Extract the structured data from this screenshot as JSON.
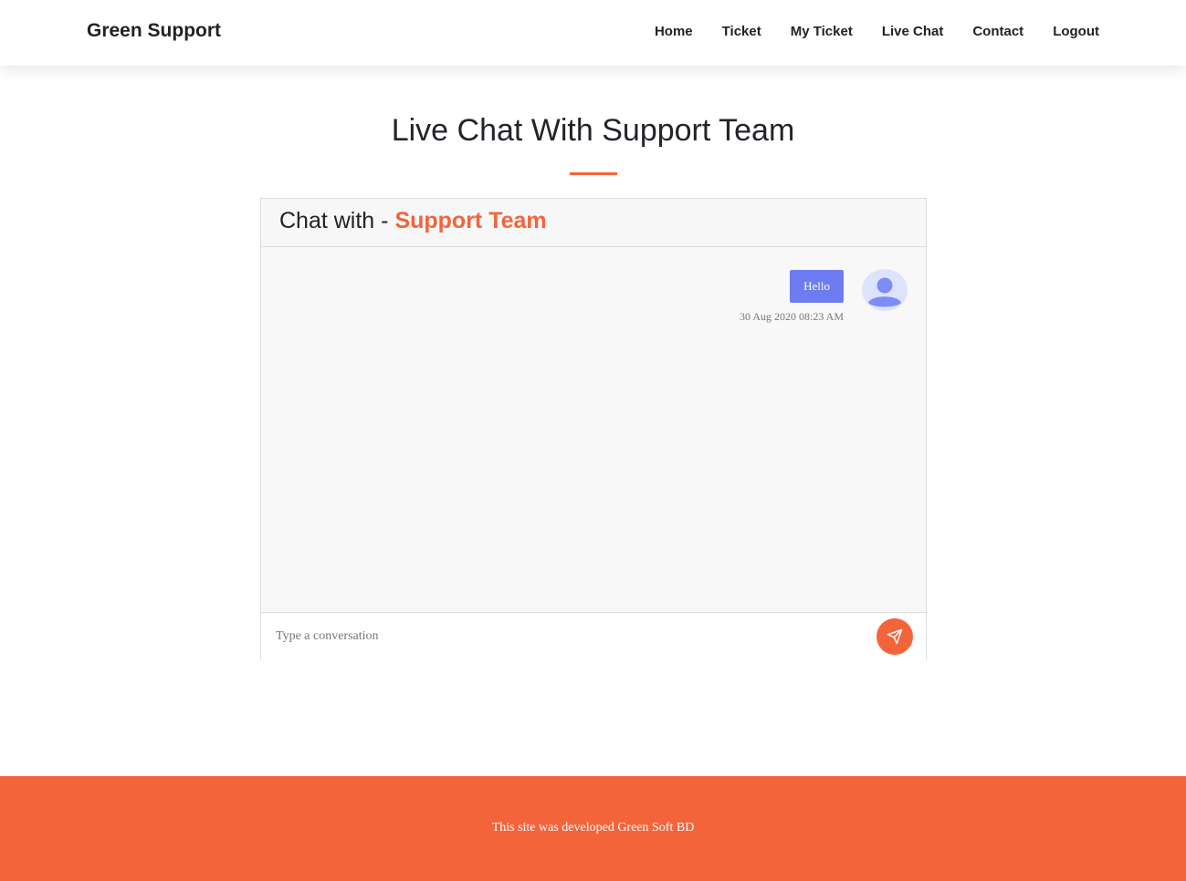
{
  "brand": {
    "name": "Green Support"
  },
  "nav": {
    "items": [
      {
        "label": "Home"
      },
      {
        "label": "Ticket"
      },
      {
        "label": "My Ticket"
      },
      {
        "label": "Live Chat"
      },
      {
        "label": "Contact"
      },
      {
        "label": "Logout"
      }
    ]
  },
  "page": {
    "title": "Live Chat With Support Team"
  },
  "chat": {
    "header_prefix": "Chat with -",
    "header_name": "Support Team",
    "messages": [
      {
        "text": "Hello",
        "time": "30 Aug 2020 08:23 AM",
        "avatar_icon": "user-avatar-icon"
      }
    ],
    "input": {
      "placeholder": "Type a conversation",
      "value": ""
    },
    "send_icon": "paper-plane-icon"
  },
  "footer": {
    "text": "This site was developed Green Soft BD"
  },
  "colors": {
    "accent": "#f4643b",
    "bubble": "#6d7cf0",
    "avatar_bg": "#dde3fb",
    "avatar_fg": "#7e8df5"
  }
}
